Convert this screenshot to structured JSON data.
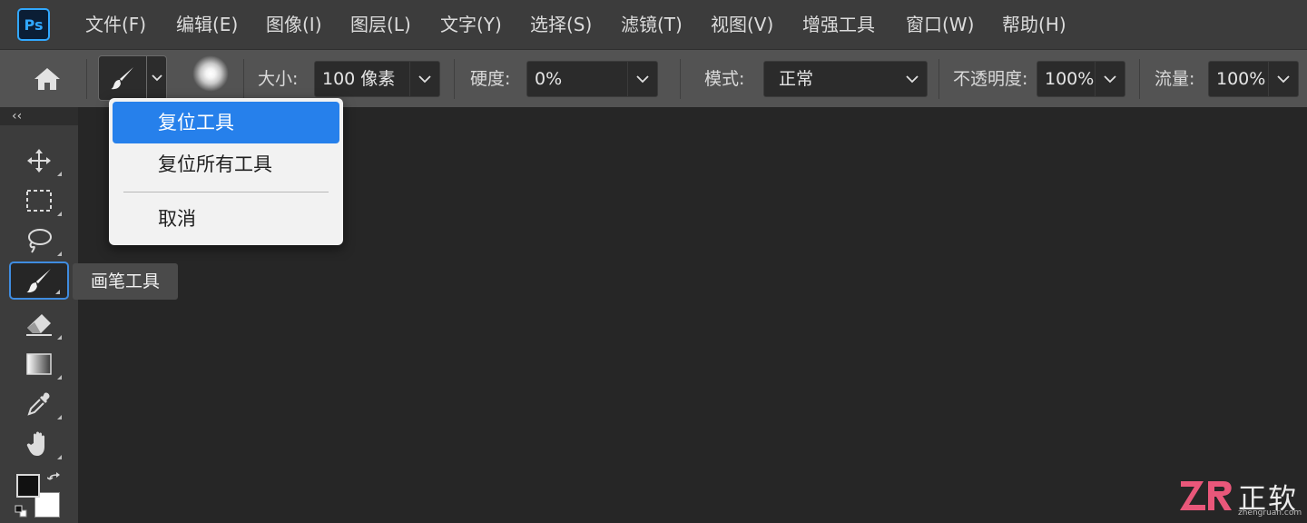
{
  "app": {
    "logo_text": "Ps"
  },
  "menubar": {
    "items": [
      "文件(F)",
      "编辑(E)",
      "图像(I)",
      "图层(L)",
      "文字(Y)",
      "选择(S)",
      "滤镜(T)",
      "视图(V)",
      "增强工具",
      "窗口(W)",
      "帮助(H)"
    ]
  },
  "options": {
    "size_label": "大小:",
    "size_value": "100 像素",
    "hardness_label": "硬度:",
    "hardness_value": "0%",
    "mode_label": "模式:",
    "mode_value": "正常",
    "opacity_label": "不透明度:",
    "opacity_value": "100%",
    "flow_label": "流量:",
    "flow_value": "100%"
  },
  "toolbar": {
    "collapse_glyph": "‹‹",
    "tools": [
      {
        "name": "move-tool",
        "icon": "move-icon"
      },
      {
        "name": "marquee-tool",
        "icon": "marquee-icon"
      },
      {
        "name": "lasso-tool",
        "icon": "lasso-icon"
      },
      {
        "name": "brush-tool",
        "icon": "brush-icon",
        "active": true
      },
      {
        "name": "eraser-tool",
        "icon": "eraser-icon"
      },
      {
        "name": "gradient-tool",
        "icon": "gradient-icon"
      },
      {
        "name": "eyedropper-tool",
        "icon": "eyedropper-icon"
      },
      {
        "name": "hand-tool",
        "icon": "hand-icon"
      }
    ],
    "foreground_color": "#111111",
    "background_color": "#ffffff"
  },
  "context_menu": {
    "items": [
      "复位工具",
      "复位所有工具",
      "取消"
    ],
    "highlighted_index": 0
  },
  "tooltip": {
    "text": "画笔工具"
  },
  "watermark": {
    "name": "正软",
    "url": "zhengruan.com"
  },
  "colors": {
    "accent": "#2680eb",
    "ps_blue": "#31a8ff",
    "menubar_bg": "#3c3c3c",
    "options_bg": "#535353",
    "canvas_bg": "#262626"
  }
}
